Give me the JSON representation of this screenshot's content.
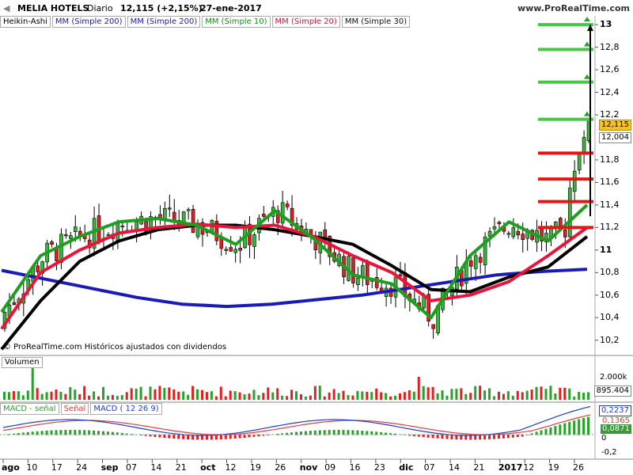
{
  "header": {
    "symbol": "MELIA HOTELS",
    "period": "Diario",
    "price_change": "12,115 (+2,15%)",
    "date": "27-ene-2017",
    "site": "www.ProRealTime.com"
  },
  "legend": {
    "heikin": "Heikin-Ashi",
    "ma200a": "MM (Simple 200)",
    "ma200b": "MM (Simple 200)",
    "ma10": "MM (Simple 10)",
    "ma20": "MM (Simple 20)",
    "ma30": "MM (Simple 30)"
  },
  "watermark": "© ProRealTime.com Históricos ajustados con dividendos",
  "price_axis": {
    "ticks": [
      "13",
      "12,8",
      "12,6",
      "12,4",
      "12,2",
      "11,8",
      "11,6",
      "11,4",
      "11,2",
      "11",
      "10,8",
      "10,6",
      "10,4",
      "10,2"
    ],
    "tick_values": [
      13,
      12.8,
      12.6,
      12.4,
      12.2,
      11.8,
      11.6,
      11.4,
      11.2,
      11,
      10.8,
      10.6,
      10.4,
      10.2
    ],
    "last_price": "12,115",
    "secondary_price": "12,004"
  },
  "volume_panel": {
    "title": "Volumen",
    "tick": "2.000k",
    "last_value": "895.404"
  },
  "macd_panel": {
    "label1": "MACD - señal",
    "label2": "Señal",
    "label3": "MACD ( 12 26 9)",
    "values": [
      "0,2237",
      "0,1365",
      "0,0871"
    ],
    "ticks": [
      "0",
      "-0,2"
    ]
  },
  "x_axis": {
    "labels": [
      "ago",
      "10",
      "17",
      "24",
      "sep",
      "07",
      "14",
      "21",
      "oct",
      "12",
      "19",
      "26",
      "nov",
      "09",
      "16",
      "23",
      "dic",
      "07",
      "14",
      "21",
      "2017",
      "12",
      "19",
      "26"
    ],
    "bold": [
      "ago",
      "sep",
      "oct",
      "nov",
      "dic",
      "2017"
    ]
  },
  "chart_data": {
    "type": "candlestick",
    "ylim": [
      10.1,
      13.05
    ],
    "ma200": [
      10.82,
      10.74,
      10.66,
      10.58,
      10.52,
      10.5,
      10.52,
      10.56,
      10.6,
      10.66,
      10.72,
      10.78,
      10.81,
      10.83
    ],
    "ma30": [
      10.12,
      10.55,
      10.9,
      11.08,
      11.18,
      11.22,
      11.22,
      11.18,
      11.12,
      11.05,
      10.86,
      10.65,
      10.63,
      10.76,
      10.85,
      11.12
    ],
    "ma20": [
      10.3,
      10.8,
      11.0,
      11.15,
      11.2,
      11.23,
      11.2,
      11.22,
      11.12,
      10.95,
      10.8,
      10.55,
      10.6,
      10.72,
      10.95,
      11.2
    ],
    "ma10": [
      10.45,
      10.95,
      11.12,
      11.25,
      11.28,
      11.22,
      11.05,
      11.35,
      11.1,
      10.78,
      10.7,
      10.4,
      10.95,
      11.25,
      11.08,
      11.4
    ],
    "horizontal_levels_green": [
      13.0,
      12.78,
      12.49,
      12.16
    ],
    "horizontal_levels_red": [
      11.86,
      11.63,
      11.43,
      11.2
    ]
  }
}
